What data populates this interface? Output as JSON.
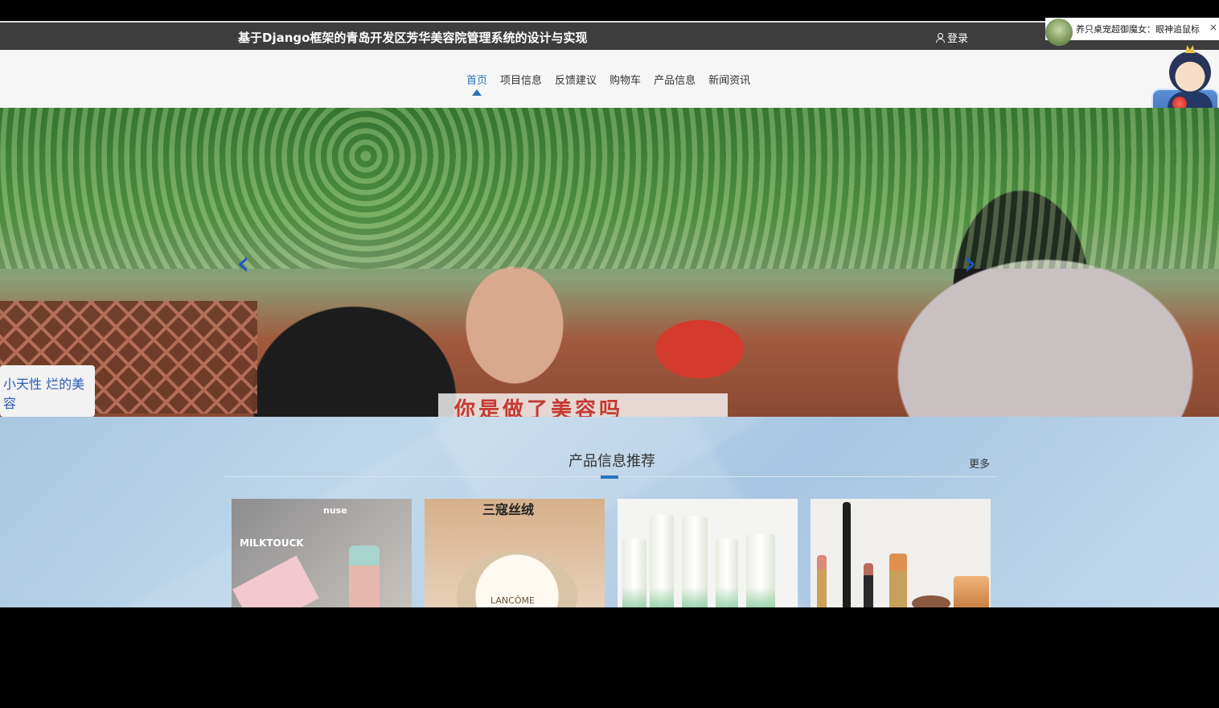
{
  "header": {
    "site_title": "基于Django框架的青岛开发区芳华美容院管理系统的设计与实现",
    "login_label": "登录"
  },
  "notification": {
    "text": "养只桌宠超御魔女：眼神追鼠标",
    "close_glyph": "×"
  },
  "nav": {
    "items": [
      {
        "label": "首页",
        "active": true
      },
      {
        "label": "项目信息",
        "active": false
      },
      {
        "label": "反馈建议",
        "active": false
      },
      {
        "label": "购物车",
        "active": false
      },
      {
        "label": "产品信息",
        "active": false
      },
      {
        "label": "新闻资讯",
        "active": false
      }
    ]
  },
  "banner": {
    "caption": "你是做了美容吗",
    "sign_text": "小天性 烂的美容",
    "prev_glyph": "‹",
    "next_glyph": "›"
  },
  "products": {
    "section_title": "产品信息推荐",
    "more_label": "更多",
    "cards": [
      {
        "brand_small": "nuse",
        "brand_large": "MILKTOUCK"
      },
      {
        "brand_large": "三寇丝绒",
        "brand_small": "LANCÔME"
      },
      {
        "brand_large": ""
      },
      {
        "brand_large": ""
      }
    ]
  },
  "colors": {
    "accent": "#2a73b8",
    "header_bg": "#3d3d3d",
    "nav_bg": "#f6f6f6",
    "section_bg": "#b3cfe6"
  }
}
